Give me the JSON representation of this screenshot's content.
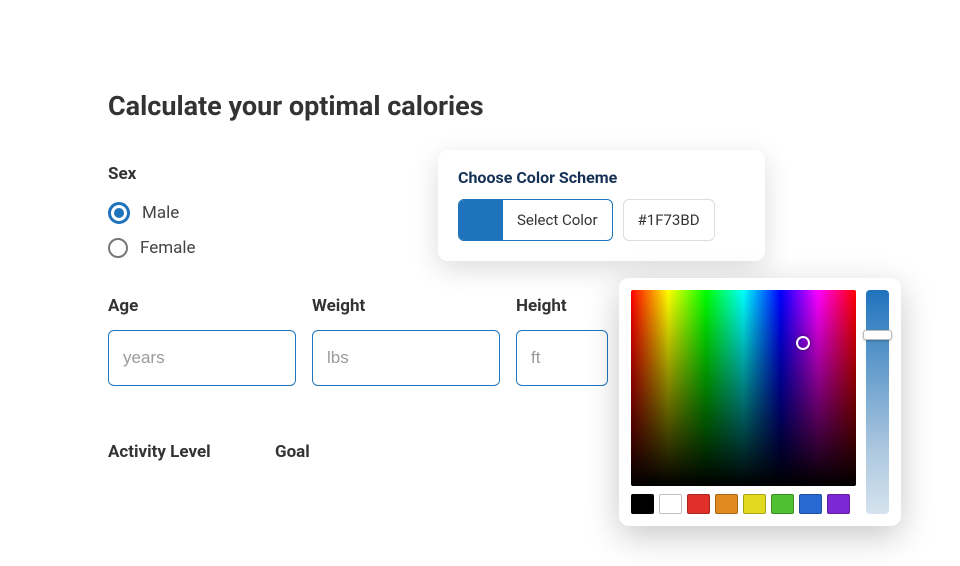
{
  "title": "Calculate your optimal calories",
  "sex": {
    "label": "Sex",
    "options": {
      "male": "Male",
      "female": "Female"
    },
    "selected": "male"
  },
  "fields": {
    "age": {
      "label": "Age",
      "placeholder": "years",
      "value": ""
    },
    "weight": {
      "label": "Weight",
      "placeholder": "lbs",
      "value": ""
    },
    "height": {
      "label": "Height",
      "placeholder": "ft",
      "value": ""
    }
  },
  "row2": {
    "activity_label": "Activity Level",
    "goal_label": "Goal"
  },
  "color_card": {
    "title": "Choose Color Scheme",
    "button_label": "Select Color",
    "hex": "#1F73BD"
  },
  "picker": {
    "presets": [
      "black",
      "white",
      "red",
      "orange",
      "yellow",
      "green",
      "blue",
      "purple"
    ]
  }
}
